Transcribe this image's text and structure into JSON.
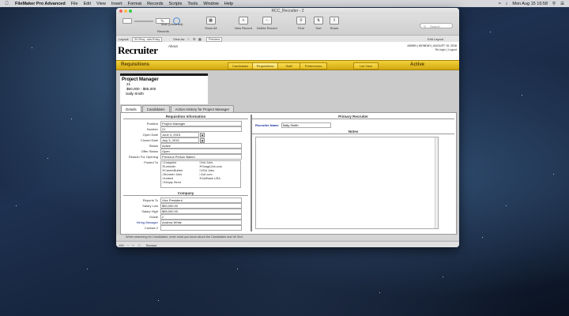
{
  "menubar": {
    "app": "FileMaker Pro Advanced",
    "items": [
      "File",
      "Edit",
      "View",
      "Insert",
      "Format",
      "Records",
      "Scripts",
      "Tools",
      "Window",
      "Help"
    ],
    "clock": "Mon Aug 15  16:58"
  },
  "window": {
    "title": "RCC_Recruiter - 2"
  },
  "toolbar": {
    "record_current": "1",
    "record_info_1": "1",
    "record_info_2": "Total (Unsorted)",
    "records_label": "Records",
    "show_all": "Show All",
    "new_record": "New Record",
    "delete_record": "Delete Record",
    "find": "Find",
    "sort": "Sort",
    "share": "Share",
    "search_placeholder": "Search"
  },
  "layoutbar": {
    "layout_label": "Layout:",
    "layout_value": "20 Req...ata Entry",
    "view_as": "View As:",
    "preview": "Preview",
    "edit_layout": "Edit Layout"
  },
  "header": {
    "logo": "Recruiter",
    "about": "About",
    "admin_line": "ADMIN  |  MONDAY | AUGUST 15, 2016",
    "relogin": "Re-login",
    "logout": "Logout"
  },
  "nav": {
    "title": "Requisitions",
    "tabs": [
      "Candidates",
      "Requisitions",
      "Staff",
      "Preferences"
    ],
    "list_view": "List View",
    "status": "Active"
  },
  "requisition": {
    "title": "Project Manager",
    "number": "21",
    "salary_range": "$50,000 - $65,000",
    "owner": "Sally Smith"
  },
  "detail_tabs": [
    "Details",
    "Candidates",
    "Action History for Project Manager"
  ],
  "req_info": {
    "heading": "Requisition Information",
    "fields": [
      {
        "label": "Position",
        "value": "Project Manager"
      },
      {
        "label": "Number",
        "value": "21"
      },
      {
        "label": "Open Date",
        "value": "June 4, 2015"
      },
      {
        "label": "Closed Date",
        "value": "July 3, 2015"
      },
      {
        "label": "Status",
        "value": "Active"
      },
      {
        "label": "Offer Status",
        "value": "Open"
      },
      {
        "label": "Reason For Opening",
        "value": "Previous Person Bailed"
      }
    ],
    "posted_label": "Posted To",
    "posted": {
      "col1": [
        "Craigslist",
        "Linkedin",
        "CareerBuilder",
        "Monster Jobs",
        "Indeed",
        "Simply Hired"
      ],
      "col2": [
        "Hot Jobs",
        "SnagAJob.com",
        "USA Jobs",
        "Job.com",
        "JobBank USA"
      ]
    }
  },
  "company": {
    "heading": "Company",
    "fields": [
      {
        "label": "Reports To",
        "value": "Vice President"
      },
      {
        "label": "Salary Low",
        "value": "$50,000.00"
      },
      {
        "label": "Salary High",
        "value": "$65,000.00"
      },
      {
        "label": "Grade",
        "value": "2"
      },
      {
        "label": "Hiring Manager",
        "value": "Andrew White"
      },
      {
        "label": "Contact 2",
        "value": ""
      }
    ]
  },
  "recruiter": {
    "heading": "Primary Recruiter",
    "label": "Recruiter Name",
    "value": "Sally Smith",
    "notes_heading": "Notes"
  },
  "hint": "When searching for Candidates, enter what you know about the Candidates and hit 'find'",
  "status": {
    "zoom": "100",
    "mode": "Browse"
  }
}
